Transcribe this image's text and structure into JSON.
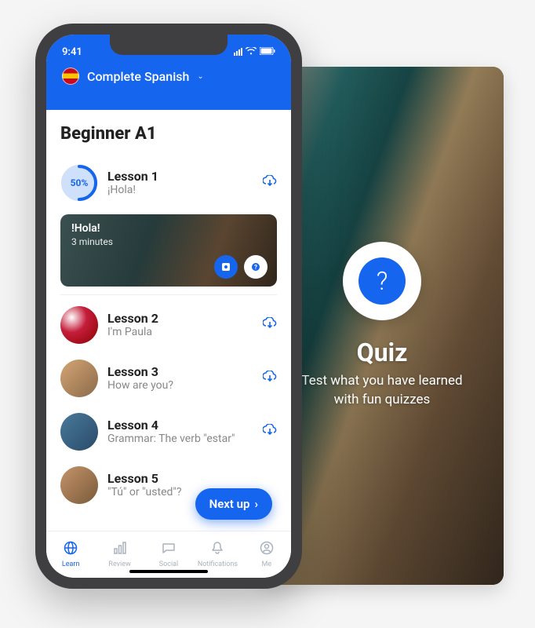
{
  "status": {
    "time": "9:41"
  },
  "header": {
    "course_name": "Complete Spanish",
    "flag": "spain"
  },
  "level_title": "Beginner A1",
  "lessons": [
    {
      "title": "Lesson 1",
      "subtitle": "¡Hola!",
      "progress_pct": "50%",
      "progress_value": 50,
      "expanded": {
        "title": "!Hola!",
        "duration": "3 minutes"
      }
    },
    {
      "title": "Lesson 2",
      "subtitle": "I'm Paula"
    },
    {
      "title": "Lesson 3",
      "subtitle": "How are you?"
    },
    {
      "title": "Lesson 4",
      "subtitle": "Grammar: The verb \"estar\""
    },
    {
      "title": "Lesson 5",
      "subtitle": "\"Tú\" or \"usted\"?"
    }
  ],
  "fab_label": "Next up",
  "nav": {
    "items": [
      {
        "label": "Learn",
        "icon": "globe"
      },
      {
        "label": "Review",
        "icon": "chart"
      },
      {
        "label": "Social",
        "icon": "chat"
      },
      {
        "label": "Notifications",
        "icon": "bell"
      },
      {
        "label": "Me",
        "icon": "user"
      }
    ],
    "active_index": 0
  },
  "quiz_card": {
    "title": "Quiz",
    "subtitle": "Test what you have learned\nwith fun quizzes"
  },
  "colors": {
    "accent": "#1565ef"
  }
}
